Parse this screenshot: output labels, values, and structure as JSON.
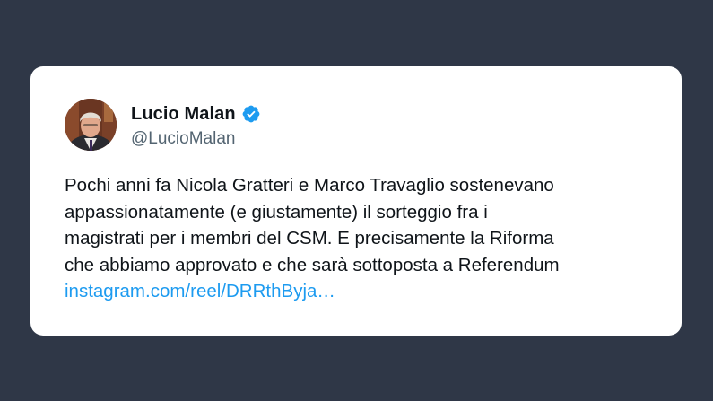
{
  "tweet": {
    "author": {
      "display_name": "Lucio Malan",
      "handle": "@LucioMalan",
      "verified": true,
      "verified_icon": "verified-badge-icon"
    },
    "text_lines": [
      "Pochi anni fa Nicola Gratteri e Marco Travaglio sostenevano",
      "appassionatamente (e giustamente) il sorteggio fra i",
      "magistrati per i membri del CSM. E precisamente la Riforma",
      "che abbiamo approvato e che sarà sottoposta a Referendum"
    ],
    "link": "instagram.com/reel/DRRthByja…"
  },
  "colors": {
    "background": "#2f3747",
    "card": "#ffffff",
    "text": "#0f1419",
    "secondary_text": "#536471",
    "link": "#1d9bf0",
    "verified": "#1d9bf0"
  }
}
